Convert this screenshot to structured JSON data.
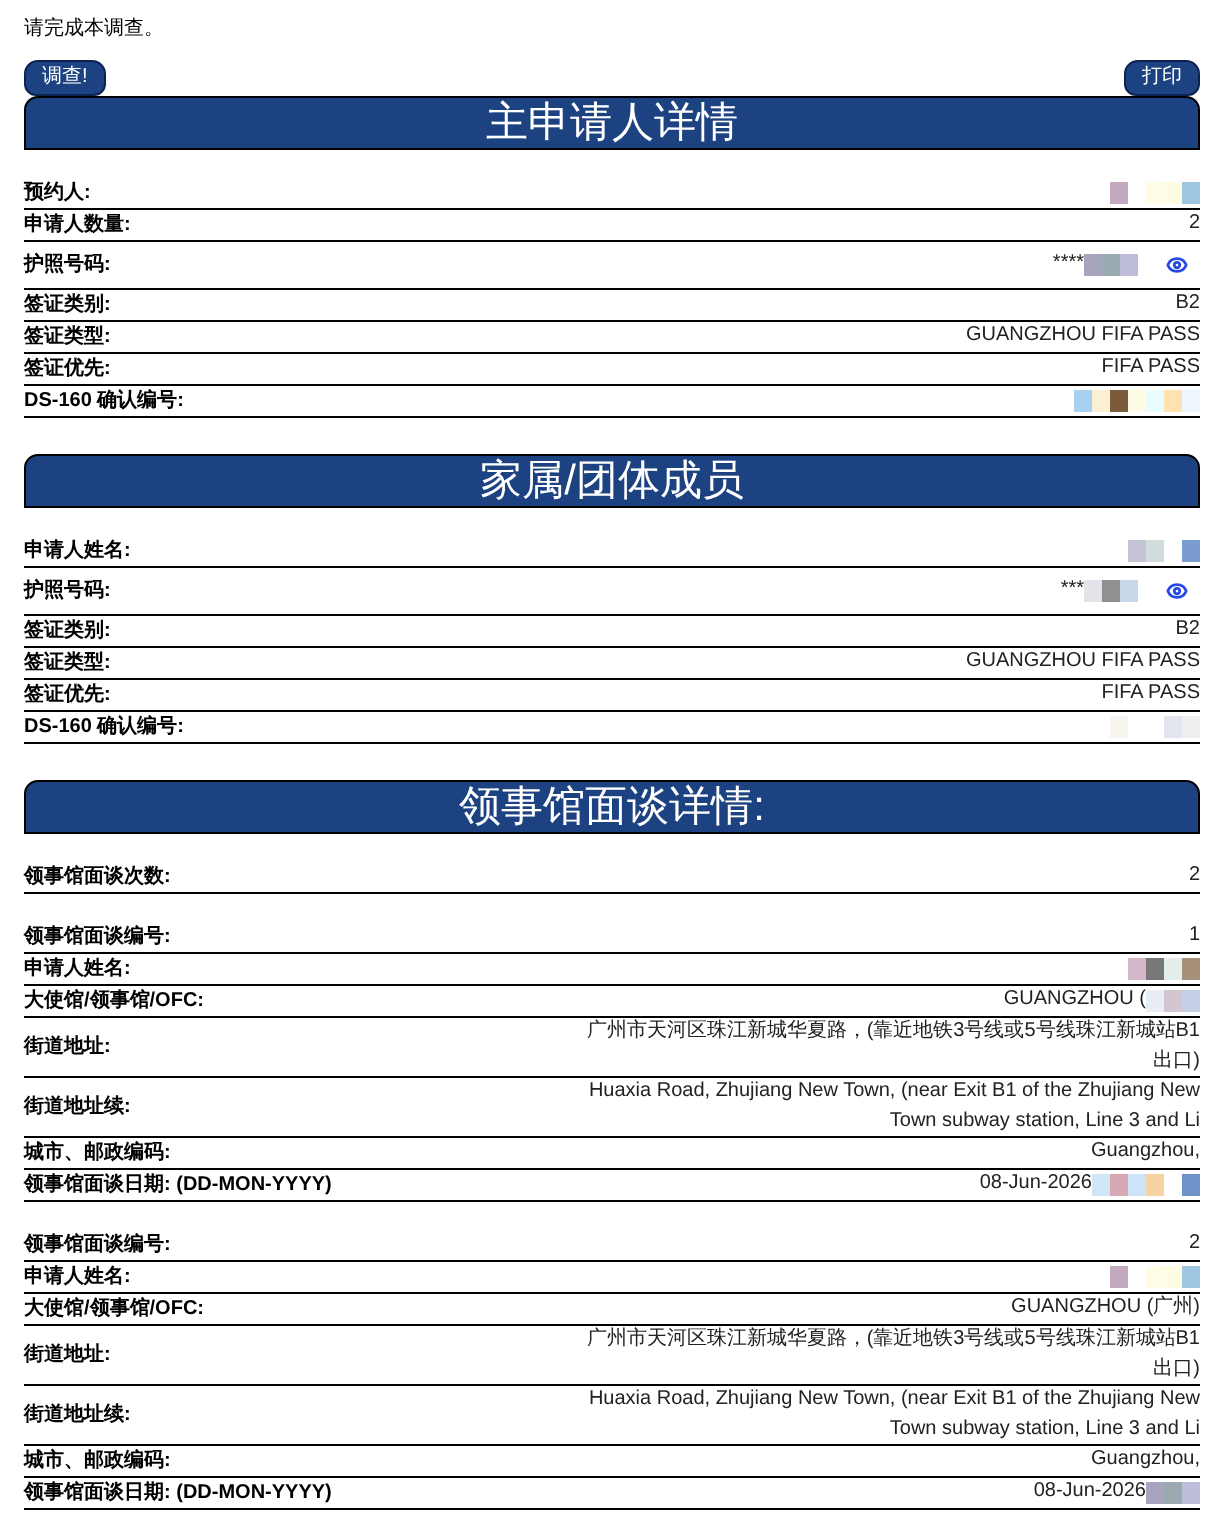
{
  "intro": "请完成本调查。",
  "survey_button": "调查!",
  "print_button": "打印",
  "sections": [
    {
      "title": "主申请人详情",
      "groups": [
        {
          "rows": [
            {
              "label": "预约人:",
              "kind": "text",
              "redacted": true
            },
            {
              "label": "申请人数量:",
              "value": "2",
              "kind": "text",
              "redacted": false
            },
            {
              "label": "护照号码:",
              "value": "****",
              "kind": "secret",
              "redacted": true
            },
            {
              "label": "签证类别:",
              "value": "B2",
              "kind": "text",
              "redacted": false
            },
            {
              "label": "签证类型:",
              "value": "GUANGZHOU FIFA PASS",
              "kind": "text",
              "redacted": false
            },
            {
              "label": "签证优先:",
              "value": "FIFA PASS",
              "kind": "text",
              "redacted": false
            },
            {
              "label": "DS-160 确认编号:",
              "kind": "text",
              "redacted": true
            }
          ]
        }
      ]
    },
    {
      "title": "家属/团体成员",
      "groups": [
        {
          "rows": [
            {
              "label": "申请人姓名:",
              "kind": "text",
              "redacted": true
            },
            {
              "label": "护照号码:",
              "value": "***",
              "kind": "secret",
              "redacted": true
            },
            {
              "label": "签证类别:",
              "value": "B2",
              "kind": "text",
              "redacted": false
            },
            {
              "label": "签证类型:",
              "value": "GUANGZHOU FIFA PASS",
              "kind": "text",
              "redacted": false
            },
            {
              "label": "签证优先:",
              "value": "FIFA PASS",
              "kind": "text",
              "redacted": false
            },
            {
              "label": "DS-160 确认编号:",
              "kind": "text",
              "redacted": true
            }
          ]
        }
      ]
    },
    {
      "title": "领事馆面谈详情:",
      "groups": [
        {
          "rows": [
            {
              "label": "领事馆面谈次数:",
              "value": "2",
              "kind": "text",
              "redacted": false
            }
          ]
        },
        {
          "rows": [
            {
              "label": "领事馆面谈编号:",
              "value": "1",
              "kind": "text",
              "redacted": false
            },
            {
              "label": "申请人姓名:",
              "kind": "text",
              "redacted": true
            },
            {
              "label": "大使馆/领事馆/OFC:",
              "value": "GUANGZHOU (",
              "kind": "text",
              "redacted": true
            },
            {
              "label": "街道地址:",
              "value": "广州市天河区珠江新城华夏路，(靠近地铁3号线或5号线珠江新城站B1出口)",
              "kind": "text",
              "redacted": false
            },
            {
              "label": "街道地址续:",
              "value": "Huaxia Road, Zhujiang New Town, (near Exit B1 of the Zhujiang New Town subway station, Line 3 and Li",
              "kind": "text",
              "redacted": false
            },
            {
              "label": "城市、邮政编码:",
              "value": "Guangzhou,",
              "kind": "text",
              "redacted": false
            },
            {
              "label": "领事馆面谈日期: (DD-MON-YYYY)",
              "value": "08-Jun-2026",
              "kind": "text",
              "redacted": true
            }
          ]
        },
        {
          "rows": [
            {
              "label": "领事馆面谈编号:",
              "value": "2",
              "kind": "text",
              "redacted": false
            },
            {
              "label": "申请人姓名:",
              "kind": "text",
              "redacted": true
            },
            {
              "label": "大使馆/领事馆/OFC:",
              "value": "GUANGZHOU (广州)",
              "kind": "text",
              "redacted": false
            },
            {
              "label": "街道地址:",
              "value": "广州市天河区珠江新城华夏路，(靠近地铁3号线或5号线珠江新城站B1出口)",
              "kind": "text",
              "redacted": false
            },
            {
              "label": "街道地址续:",
              "value": "Huaxia Road, Zhujiang New Town, (near Exit B1 of the Zhujiang New Town subway station, Line 3 and Li",
              "kind": "text",
              "redacted": false
            },
            {
              "label": "城市、邮政编码:",
              "value": "Guangzhou,",
              "kind": "text",
              "redacted": false
            },
            {
              "label": "领事馆面谈日期: (DD-MON-YYYY)",
              "value": "08-Jun-2026",
              "kind": "text",
              "redacted": true
            }
          ]
        }
      ]
    }
  ]
}
